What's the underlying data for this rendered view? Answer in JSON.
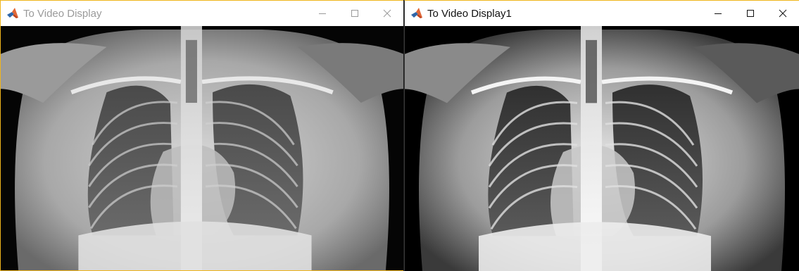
{
  "windows": [
    {
      "title": "To Video Display",
      "active": false,
      "controls": {
        "minimize": "minimize-icon",
        "maximize": "maximize-icon",
        "close": "close-icon"
      },
      "image": "chest-xray-original"
    },
    {
      "title": "To Video Display1",
      "active": true,
      "controls": {
        "minimize": "minimize-icon",
        "maximize": "maximize-icon",
        "close": "close-icon"
      },
      "image": "chest-xray-enhanced"
    }
  ],
  "colors": {
    "active_border": "#f0b51b",
    "title_inactive": "#9a9a9a",
    "title_active": "#111111",
    "matlab_orange": "#e16737",
    "matlab_blue": "#2f66a8"
  }
}
